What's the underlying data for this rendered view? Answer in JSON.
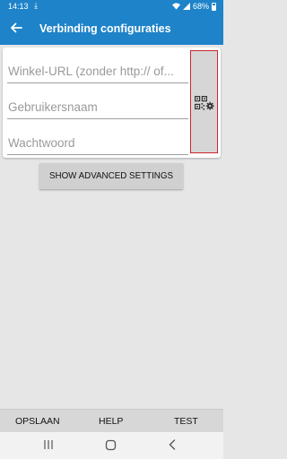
{
  "status_bar": {
    "time": "14:13",
    "download_icon": "download-icon",
    "battery": "68%"
  },
  "app_bar": {
    "title": "Verbinding configuraties",
    "back_icon": "arrow-back-icon"
  },
  "form": {
    "url_placeholder": "Winkel-URL (zonder http:// of...",
    "username_placeholder": "Gebruikersnaam",
    "password_placeholder": "Wachtwoord",
    "qr_icon": "qr-code-settings-icon"
  },
  "advanced_button": "SHOW ADVANCED SETTINGS",
  "bottom_bar": {
    "save": "OPSLAAN",
    "help": "HELP",
    "test": "TEST"
  },
  "nav_bar": {
    "recents_icon": "recents-icon",
    "home_icon": "home-icon",
    "back_icon": "back-icon"
  },
  "colors": {
    "primary": "#1e83c9",
    "background": "#e6e6e6",
    "qr_border": "#c9262b"
  }
}
